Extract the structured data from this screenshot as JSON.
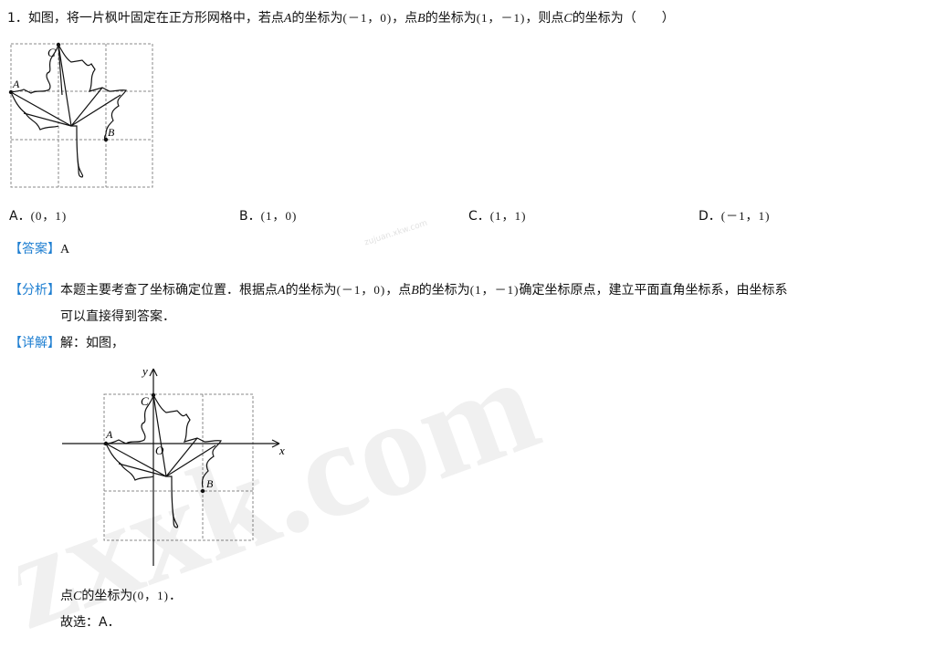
{
  "question": {
    "number": "1",
    "sep": "．",
    "text1": "如图，将一片枫叶固定在正方形网格中，若点",
    "A": "A",
    "text2": "的坐标为",
    "coordA": "(－1，0)",
    "text3": "，点",
    "B": "B",
    "text4": "的坐标为",
    "coordB": "(1，－1)",
    "text5": "，则点",
    "C": "C",
    "text6": "的坐标为（　　）"
  },
  "figure1": {
    "label_A": "A",
    "label_B": "B",
    "label_C": "C"
  },
  "options": [
    {
      "letter": "A．",
      "value": "(0，1)"
    },
    {
      "letter": "B．",
      "value": "(1，0)"
    },
    {
      "letter": "C．",
      "value": "(1，1)"
    },
    {
      "letter": "D．",
      "value": "(－1，1)"
    }
  ],
  "answer": {
    "tag": "【答案】",
    "value": "A"
  },
  "analysis": {
    "tag": "【分析】",
    "line1a": "本题主要考查了坐标确定位置．根据点",
    "A": "A",
    "line1b": "的坐标为",
    "coordA": "(－1，0)",
    "line1c": "，点",
    "B": "B",
    "line1d": "的坐标为",
    "coordB": "(1，－1)",
    "line1e": "确定坐标原点，建立平面直角坐标系，由坐标系",
    "line2": "可以直接得到答案．"
  },
  "detail": {
    "tag": "【详解】",
    "text": "解：如图，",
    "line_a": "点",
    "C": "C",
    "line_b": "的坐标为",
    "coordC": "(0，1)",
    "line_c": "．",
    "choice": "故选：A．"
  },
  "figure2": {
    "y": "y",
    "x": "x",
    "O": "O",
    "label_A": "A",
    "label_B": "B",
    "label_C": "C"
  },
  "watermark": {
    "big": "zxxk.com",
    "small": "zujuan.xkw.com"
  },
  "colors": {
    "tag_blue": "#1f7fd1",
    "grid": "#888888"
  }
}
